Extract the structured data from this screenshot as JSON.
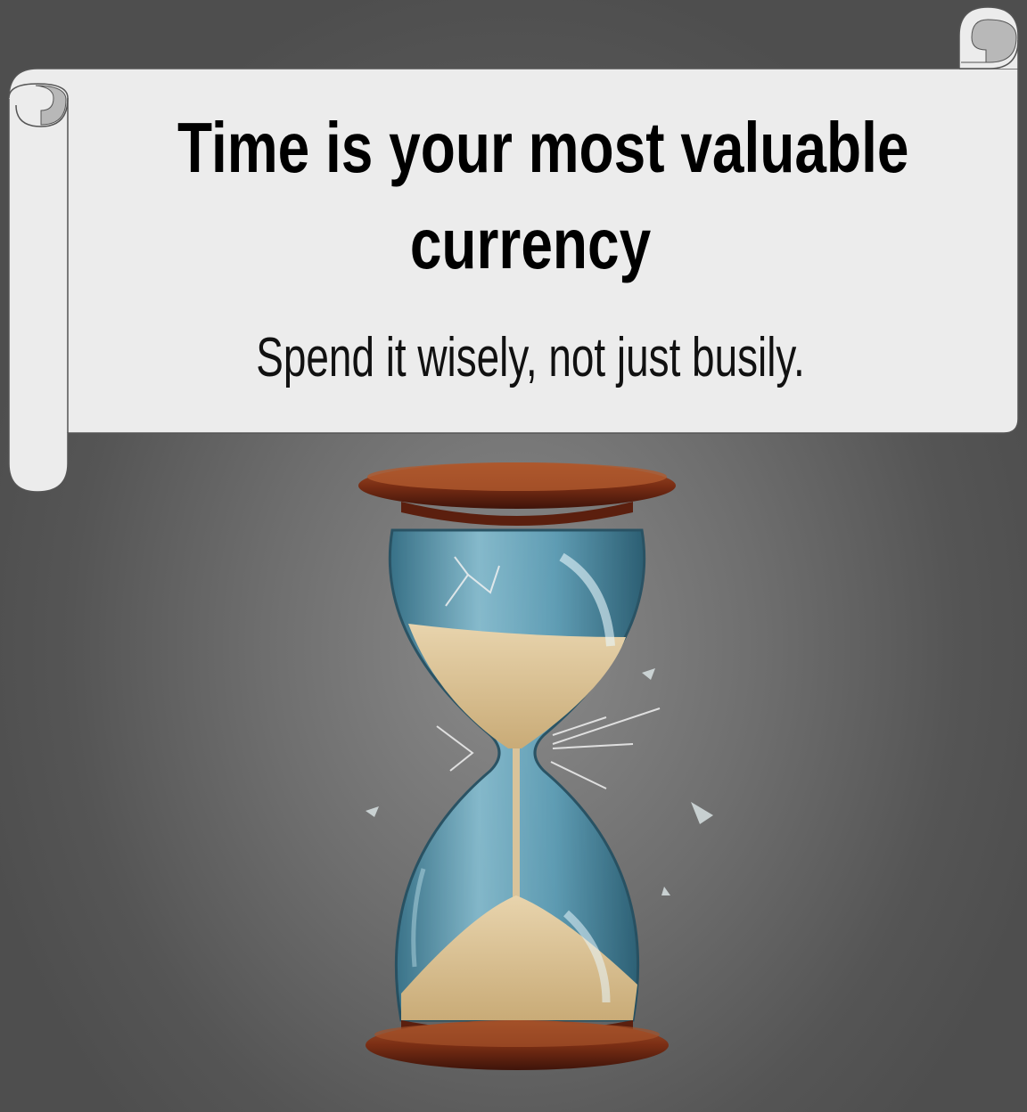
{
  "banner": {
    "headline_line1": "Time is your most valuable",
    "headline_line2": "currency",
    "subline": "Spend it wisely, not just busily."
  },
  "illustration": {
    "icon": "hourglass-icon",
    "subject": "cracked hourglass with sand"
  },
  "colors": {
    "banner_fill": "#ececec",
    "banner_stroke": "#555555",
    "wood": "#7a2e14",
    "glass": "#5fa8c4",
    "sand": "#d9c39a"
  }
}
